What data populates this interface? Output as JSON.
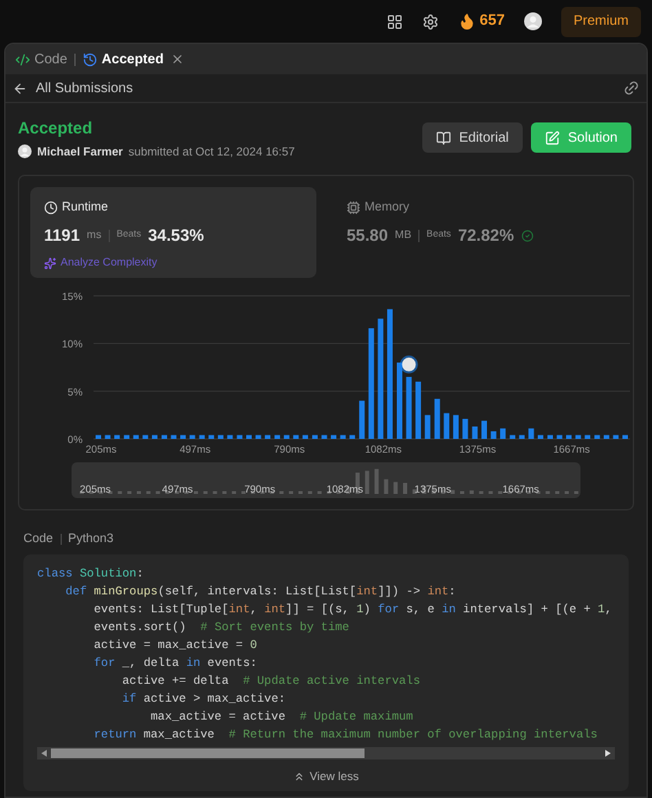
{
  "topbar": {
    "streak": "657",
    "premium": "Premium"
  },
  "tabs": [
    {
      "label": "Code",
      "kind": "code",
      "selected": false,
      "closable": false
    },
    {
      "label": "Accepted",
      "kind": "history",
      "selected": true,
      "closable": true
    }
  ],
  "nav": {
    "back": "All Submissions"
  },
  "submission": {
    "status": "Accepted",
    "author": "Michael Farmer",
    "meta": "submitted at Oct 12, 2024 16:57",
    "buttons": [
      {
        "label": "Editorial",
        "kind": "secondary"
      },
      {
        "label": "Solution",
        "kind": "primary"
      }
    ]
  },
  "stats": [
    {
      "title": "Runtime",
      "kind": "clock",
      "selected": true,
      "value": "1191",
      "unit": "ms",
      "beats_label": "Beats",
      "beats": "34.53%",
      "analyze": "Analyze Complexity"
    },
    {
      "title": "Memory",
      "kind": "chip",
      "selected": false,
      "value": "55.80",
      "unit": "MB",
      "beats_label": "Beats",
      "beats": "72.82%"
    }
  ],
  "chart_data": {
    "type": "bar",
    "xlim": [
      190,
      1857
    ],
    "ylim": [
      0,
      15
    ],
    "yticks": [
      {
        "value": 0,
        "label": "0%"
      },
      {
        "value": 5,
        "label": "5%"
      },
      {
        "value": 10,
        "label": "10%"
      },
      {
        "value": 15,
        "label": "15%"
      }
    ],
    "xticks": [
      {
        "value": 205,
        "label": "205ms"
      },
      {
        "value": 497,
        "label": "497ms"
      },
      {
        "value": 790,
        "label": "790ms"
      },
      {
        "value": 1082,
        "label": "1082ms"
      },
      {
        "value": 1375,
        "label": "1375ms"
      },
      {
        "value": 1667,
        "label": "1667ms"
      }
    ],
    "x": [
      205,
      234,
      263,
      293,
      322,
      351,
      380,
      410,
      439,
      468,
      497,
      527,
      556,
      585,
      614,
      644,
      673,
      702,
      731,
      761,
      790,
      819,
      848,
      878,
      907,
      936,
      965,
      994,
      1024,
      1053,
      1082,
      1111,
      1141,
      1170,
      1199,
      1228,
      1258,
      1287,
      1316,
      1345,
      1375,
      1404,
      1433,
      1462,
      1492,
      1521,
      1550,
      1579,
      1609,
      1638,
      1667,
      1696,
      1725,
      1755,
      1784,
      1813,
      1842
    ],
    "series": [
      {
        "color": "#1a7ee8",
        "values": [
          0.4,
          0.4,
          0.4,
          0.4,
          0.4,
          0.4,
          0.4,
          0.4,
          0.4,
          0.4,
          0.4,
          0.4,
          0.4,
          0.4,
          0.4,
          0.4,
          0.4,
          0.4,
          0.4,
          0.4,
          0.4,
          0.4,
          0.4,
          0.4,
          0.4,
          0.4,
          0.4,
          0.4,
          4,
          11.6,
          12.6,
          13.6,
          8,
          6.5,
          6,
          2.5,
          4.2,
          2.7,
          2.5,
          2.1,
          1.3,
          1.9,
          0.8,
          1.1,
          0.4,
          0.4,
          1.1,
          0.4,
          0.4,
          0.4,
          0.4,
          0.4,
          0.4,
          0.4,
          0.4,
          0.4,
          0.4
        ]
      }
    ]
  },
  "navigator": {
    "labels": [
      "205ms",
      "497ms",
      "790ms",
      "1082ms",
      "1375ms",
      "1667ms"
    ]
  },
  "code": {
    "label": "Code",
    "language": "Python3",
    "view_less": "View less",
    "lines": [
      [
        {
          "t": "class ",
          "kind": "kw"
        },
        {
          "t": "Solution",
          "kind": "cls"
        },
        {
          "t": ":",
          "kind": "p"
        }
      ],
      [
        {
          "t": "    def ",
          "kind": "kw"
        },
        {
          "t": "minGroups",
          "kind": "fn"
        },
        {
          "t": "(self, intervals: List[List[",
          "kind": "p"
        },
        {
          "t": "int",
          "kind": "ty"
        },
        {
          "t": "]]) -> ",
          "kind": "p"
        },
        {
          "t": "int",
          "kind": "ty"
        },
        {
          "t": ":",
          "kind": "p"
        }
      ],
      [
        {
          "t": "        events: List[Tuple[",
          "kind": "p"
        },
        {
          "t": "int",
          "kind": "ty"
        },
        {
          "t": ", ",
          "kind": "p"
        },
        {
          "t": "int",
          "kind": "ty"
        },
        {
          "t": "]] = [(s, ",
          "kind": "p"
        },
        {
          "t": "1",
          "kind": "num"
        },
        {
          "t": ") ",
          "kind": "p"
        },
        {
          "t": "for",
          "kind": "kw"
        },
        {
          "t": " s, e ",
          "kind": "p"
        },
        {
          "t": "in",
          "kind": "kw"
        },
        {
          "t": " intervals] + [(e + ",
          "kind": "p"
        },
        {
          "t": "1",
          "kind": "num"
        },
        {
          "t": ",",
          "kind": "p"
        }
      ],
      [
        {
          "t": "        events.sort()  ",
          "kind": "p"
        },
        {
          "t": "# Sort events by time",
          "kind": "cm"
        }
      ],
      [
        {
          "t": "        active = max_active = ",
          "kind": "p"
        },
        {
          "t": "0",
          "kind": "num"
        }
      ],
      [
        {
          "t": "        for",
          "kind": "kw"
        },
        {
          "t": " _, delta ",
          "kind": "p"
        },
        {
          "t": "in",
          "kind": "kw"
        },
        {
          "t": " events:",
          "kind": "p"
        }
      ],
      [
        {
          "t": "            active += delta  ",
          "kind": "p"
        },
        {
          "t": "# Update active intervals",
          "kind": "cm"
        }
      ],
      [
        {
          "t": "            if",
          "kind": "kw"
        },
        {
          "t": " active > max_active:",
          "kind": "p"
        }
      ],
      [
        {
          "t": "                max_active = active  ",
          "kind": "p"
        },
        {
          "t": "# Update maximum",
          "kind": "cm"
        }
      ],
      [
        {
          "t": "        return",
          "kind": "kw"
        },
        {
          "t": " max_active  ",
          "kind": "p"
        },
        {
          "t": "# Return the maximum number of overlapping intervals",
          "kind": "cm"
        }
      ]
    ]
  }
}
